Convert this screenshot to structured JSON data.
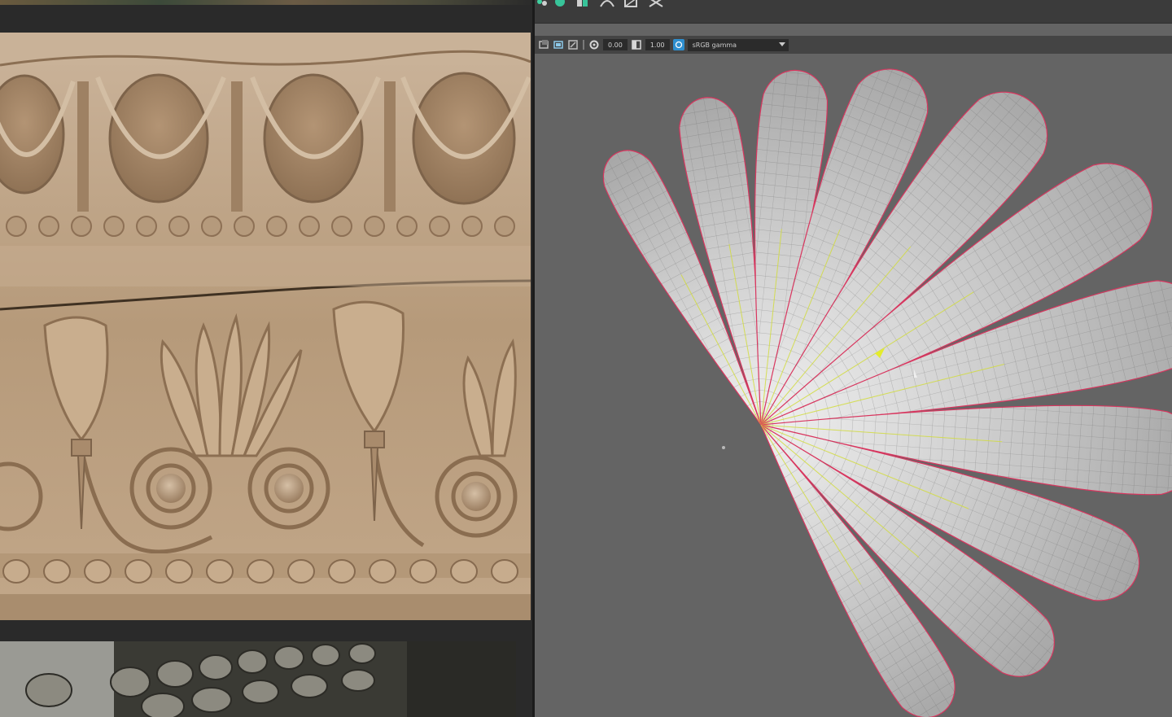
{
  "viewport_toolbar": {
    "exposure_value": "0.00",
    "gamma_value": "1.00",
    "color_space": "sRGB gamma"
  },
  "icons": {
    "shelf": [
      "cluster-icon",
      "select-icon",
      "paint-icon",
      "lattice-icon",
      "curve-icon"
    ],
    "toolbar": [
      "camera-attr-icon",
      "bookmark-icon",
      "film-gate-icon",
      "exposure-icon",
      "gamma-icon",
      "color-management-icon"
    ]
  },
  "colors": {
    "viewport_bg": "#646464",
    "wire_highlight": "#d9365f",
    "selection_yellow": "#d8e33a"
  }
}
